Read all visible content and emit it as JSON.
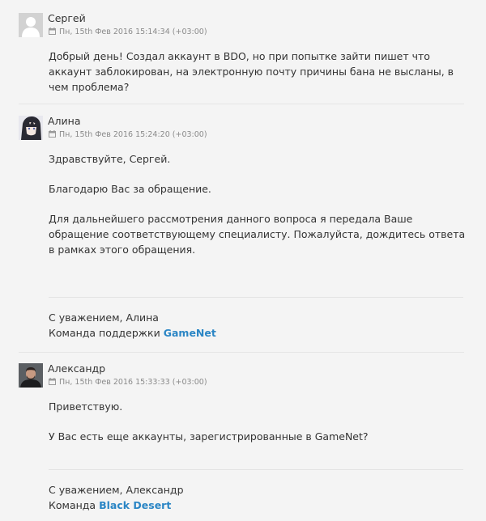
{
  "messages": [
    {
      "author": "Сергей",
      "timestamp": "Пн, 15th Фев 2016 15:14:34 (+03:00)",
      "avatar": "default-user-avatar",
      "paragraphs": [
        "Добрый день! Создал аккаунт в BDO, но при попытке зайти пишет что аккаунт заблокирован, на электронную почту причины бана не высланы, в чем проблема?"
      ]
    },
    {
      "author": "Алина",
      "timestamp": "Пн, 15th Фев 2016 15:24:20 (+03:00)",
      "avatar": "anime-character-avatar",
      "paragraphs": [
        "Здравствуйте, Сергей.",
        "Благодарю Вас за обращение.",
        "Для дальнейшего рассмотрения данного вопроса я передала Ваше обращение соответствующему специалисту. Пожалуйста, дождитесь ответа в рамках этого обращения."
      ],
      "signature": {
        "line1": "С уважением, Алина",
        "team_prefix": "Команда поддержки",
        "team_link": "GameNet"
      }
    },
    {
      "author": "Александр",
      "timestamp": "Пн, 15th Фев 2016 15:33:33 (+03:00)",
      "avatar": "person-photo-avatar",
      "paragraphs": [
        "Приветствую.",
        "У Вас есть еще аккаунты, зарегистрированные в GameNet?"
      ],
      "signature": {
        "line1": "С уважением, Александр",
        "team_prefix": "Команда",
        "team_link": "Black Desert"
      }
    }
  ],
  "colors": {
    "background": "#f4f4f4",
    "link": "#2b86c5",
    "meta_text": "#8a8a8a"
  }
}
